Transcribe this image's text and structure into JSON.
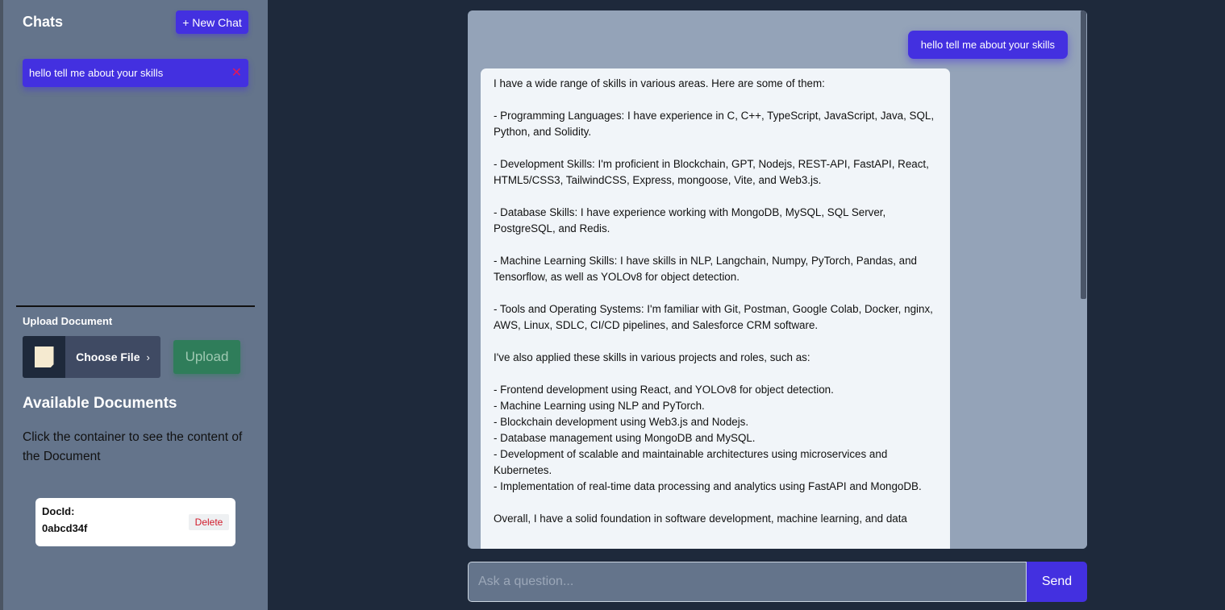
{
  "sidebar": {
    "title": "Chats",
    "new_chat_label": "+ New Chat",
    "chats": [
      {
        "label": "hello tell me about your skills",
        "close_glyph": "✕"
      }
    ],
    "upload": {
      "heading": "Upload Document",
      "choose_file_label": "Choose File",
      "chevron": "›",
      "upload_label": "Upload"
    },
    "documents": {
      "heading": "Available Documents",
      "description": "Click the container to see the content of the Document",
      "items": [
        {
          "id_label": "DocId:",
          "id_value": "0abcd34f",
          "delete_label": "Delete"
        }
      ]
    }
  },
  "chat": {
    "messages": [
      {
        "role": "user",
        "text": "hello tell me about your skills"
      },
      {
        "role": "assistant",
        "text": "I have a wide range of skills in various areas. Here are some of them:\n\n- Programming Languages: I have experience in C, C++, TypeScript, JavaScript, Java, SQL, Python, and Solidity.\n\n- Development Skills: I'm proficient in Blockchain, GPT, Nodejs, REST-API, FastAPI, React, HTML5/CSS3, TailwindCSS, Express, mongoose, Vite, and Web3.js.\n\n- Database Skills: I have experience working with MongoDB, MySQL, SQL Server, PostgreSQL, and Redis.\n\n- Machine Learning Skills: I have skills in NLP, Langchain, Numpy, PyTorch, Pandas, and Tensorflow, as well as YOLOv8 for object detection.\n\n- Tools and Operating Systems: I'm familiar with Git, Postman, Google Colab, Docker, nginx, AWS, Linux, SDLC, CI/CD pipelines, and Salesforce CRM software.\n\nI've also applied these skills in various projects and roles, such as:\n\n- Frontend development using React, and YOLOv8 for object detection.\n- Machine Learning using NLP and PyTorch.\n- Blockchain development using Web3.js and Nodejs.\n- Database management using MongoDB and MySQL.\n- Development of scalable and maintainable architectures using microservices and Kubernetes.\n- Implementation of real-time data processing and analytics using FastAPI and MongoDB.\n\nOverall, I have a solid foundation in software development, machine learning, and data"
      }
    ],
    "input": {
      "placeholder": "Ask a question...",
      "value": ""
    },
    "send_label": "Send"
  },
  "colors": {
    "accent": "#4330e0",
    "sidebar_bg": "#64748b",
    "page_bg": "#1e293b",
    "chat_panel_bg": "#94a3b8",
    "upload_green": "#2f7d5a",
    "delete_red": "#d11a2a"
  },
  "icons": [
    "file-icon",
    "close-icon",
    "chevron-right-icon"
  ]
}
